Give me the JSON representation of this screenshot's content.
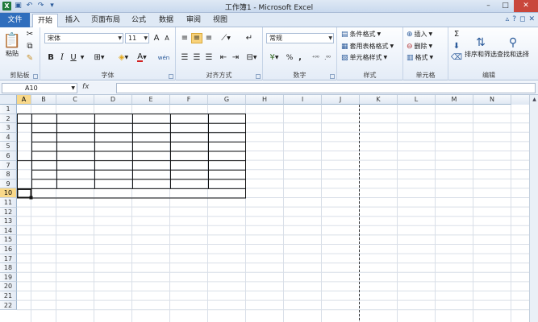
{
  "window": {
    "title": "工作簿1 - Microsoft Excel",
    "minimize": "–",
    "maximize": "□",
    "close": "✕"
  },
  "quick_access": {
    "app_icon": "X",
    "save": "▣",
    "undo": "↶",
    "redo": "↷",
    "customize": "▾"
  },
  "tabs": [
    {
      "label": "文件"
    },
    {
      "label": "开始"
    },
    {
      "label": "插入"
    },
    {
      "label": "页面布局"
    },
    {
      "label": "公式"
    },
    {
      "label": "数据"
    },
    {
      "label": "审阅"
    },
    {
      "label": "视图"
    }
  ],
  "tab_right": {
    "help": "?",
    "min_ribbon": "▵",
    "restore": "◻",
    "close": "✕"
  },
  "ribbon": {
    "clipboard": {
      "paste": "粘贴",
      "group": "剪贴板"
    },
    "font": {
      "name": "宋体",
      "size": "11",
      "bold": "B",
      "italic": "I",
      "underline": "U",
      "wen": "wén",
      "group": "字体"
    },
    "alignment": {
      "group": "对齐方式"
    },
    "number": {
      "format": "常规",
      "percent": "%",
      "comma": ",",
      "group": "数字"
    },
    "styles": {
      "conditional": "条件格式",
      "table": "套用表格格式",
      "cell_styles": "单元格样式",
      "group": "样式"
    },
    "cells": {
      "insert": "插入",
      "delete": "删除",
      "format": "格式",
      "group": "单元格"
    },
    "editing": {
      "sort": "排序和筛选",
      "find": "查找和选择",
      "sum": "Σ",
      "group": "编辑"
    }
  },
  "formula_bar": {
    "name_box": "A10",
    "fx": "fx",
    "value": ""
  },
  "columns": [
    "A",
    "B",
    "C",
    "D",
    "E",
    "F",
    "G",
    "H",
    "I",
    "J",
    "K",
    "L",
    "M",
    "N"
  ],
  "rows": [
    "1",
    "2",
    "3",
    "4",
    "5",
    "6",
    "7",
    "8",
    "9",
    "10",
    "11",
    "12",
    "13",
    "14",
    "15",
    "16",
    "17",
    "18",
    "19",
    "20",
    "21",
    "22"
  ],
  "selected_cell": "A10",
  "colors": {
    "file_tab": "#2f6ebd",
    "selection_header": "#f8d88a",
    "grid": "#d9dfe8"
  }
}
